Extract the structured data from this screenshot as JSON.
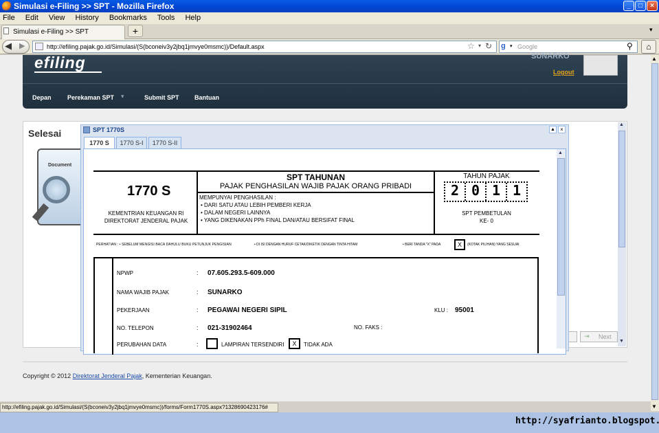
{
  "window": {
    "title": "Simulasi e-Filing >> SPT - Mozilla Firefox",
    "buttons": {
      "minimize": "_",
      "maximize": "□",
      "close": "×"
    }
  },
  "menu": [
    "File",
    "Edit",
    "View",
    "History",
    "Bookmarks",
    "Tools",
    "Help"
  ],
  "tabs": {
    "active_label": "Simulasi e-Filing >> SPT",
    "new_tab": "+"
  },
  "nav": {
    "url": "http://efiling.pajak.go.id/Simulasi/(S(bconeiv3y2jbq1jmvye0msmc))/Default.aspx",
    "search_placeholder": "Google"
  },
  "site": {
    "logo": "efiling",
    "username": "SUNARKO",
    "logout": "Logout",
    "nav_items": [
      "Depan",
      "Perekaman SPT",
      "Submit SPT",
      "Bantuan"
    ]
  },
  "content": {
    "heading": "Selesai",
    "doc_label": "Document",
    "next_button": "Next"
  },
  "dialog": {
    "title": "SPT 1770S",
    "tabs": [
      "1770 S",
      "1770 S-I",
      "1770 S-II"
    ]
  },
  "form": {
    "form_number": "1770 S",
    "kementrian_line1": "KEMENTRIAN KEUANGAN RI",
    "kementrian_line2": "DIREKTORAT JENDERAL PAJAK",
    "spt_title": "SPT TAHUNAN",
    "spt_subtitle": "PAJAK PENGHASILAN WAJIB PAJAK ORANG PRIBADI",
    "mempunyai": "MEMPUNYAI PENGHASILAN :",
    "bullets": [
      "• DARI SATU ATAU LEBIH PEMBERI KERJA",
      "• DALAM NEGERI LAINNYA",
      "• YANG DIKENAKAN PPh FINAL DAN/ATAU BERSIFAT FINAL"
    ],
    "tahun_pajak_label": "TAHUN PAJAK",
    "year_digits": [
      "2",
      "0",
      "1",
      "1"
    ],
    "pembetulan_line1": "SPT PEMBETULAN",
    "pembetulan_line2": "KE- 0",
    "perhatian_1": "PERHATIAN :   • SEBELUM MENGISI BACA DAHULU BUKU PETUNJUK PENGISIAN",
    "perhatian_2": "• DI ISI DENGAN HURUF CETAK/DIKETIK DENGAN TINTA HITAM",
    "perhatian_3": "• BERI TANDA \"X\" PADA",
    "perhatian_x": "X",
    "perhatian_4": "(KOTAK PILIHAN) YANG SESUAI",
    "fields": {
      "npwp_label": "NPWP",
      "npwp_value": "07.605.293.5-609.000",
      "nama_label": "NAMA WAJIB PAJAK",
      "nama_value": "SUNARKO",
      "pekerjaan_label": "PEKERJAAN",
      "pekerjaan_value": "PEGAWAI NEGERI SIPIL",
      "klu_label": "KLU :",
      "klu_value": "95001",
      "telepon_label": "NO. TELEPON",
      "telepon_value": "021-31902464",
      "faks_label": "NO. FAKS :",
      "perubahan_label": "PERUBAHAN DATA",
      "lampiran_label": "LAMPIRAN TERSENDIRI",
      "tidak_ada_label": "TIDAK ADA",
      "tidak_ada_mark": "X",
      "colon": ":"
    }
  },
  "footer": {
    "copyright_prefix": "Copyright © 2012 ",
    "link": "Direktorat Jenderal Pajak",
    "suffix": ", Kementerian Keuangan."
  },
  "status_bar": "http://efiling.pajak.go.id/Simulasi/(S(bconeiv3y2jbq1jmvye0msmc))/forms/Form1770S.aspx?1328690423176#",
  "watermark": "http://syafrianto.blogspot.com"
}
